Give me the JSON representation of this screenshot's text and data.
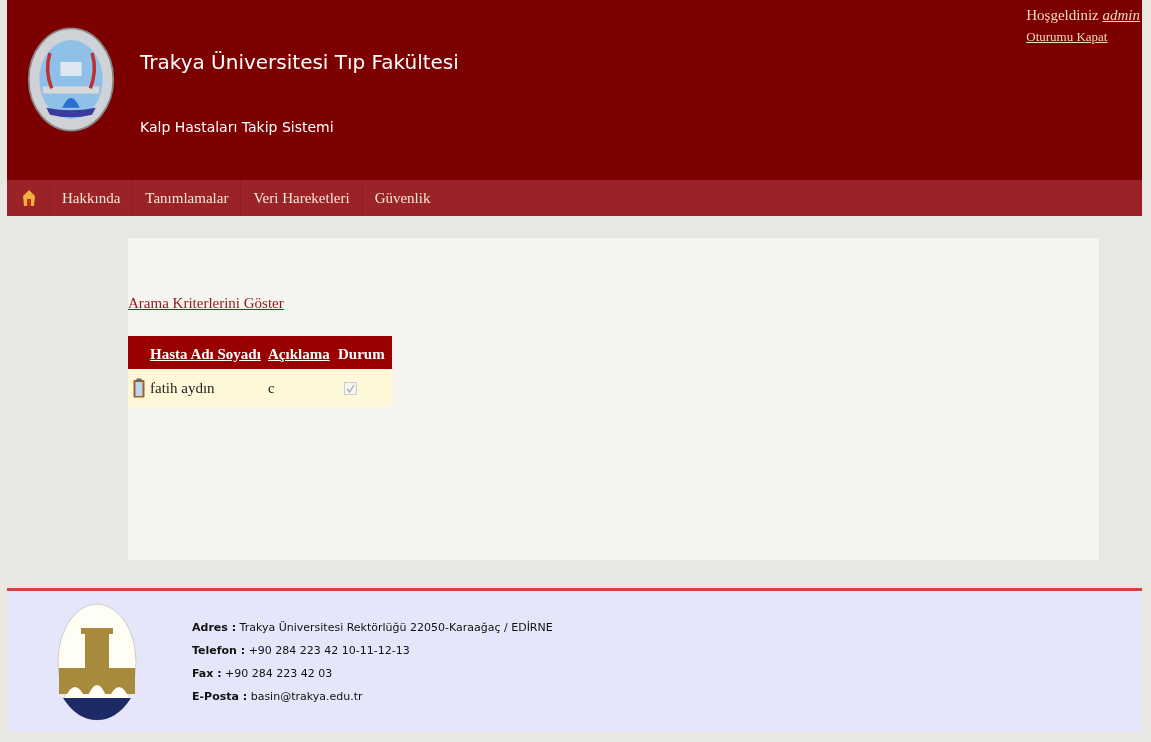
{
  "header": {
    "title": "Trakya Üniversitesi Tıp Fakültesi",
    "subtitle": "Kalp Hastaları Takip Sistemi",
    "welcome": "Hoşgeldiniz",
    "user": "admin",
    "logout": "Oturumu Kapat"
  },
  "nav": {
    "items": [
      {
        "label": "Hakkında"
      },
      {
        "label": "Tanımlamalar"
      },
      {
        "label": "Veri Hareketleri"
      },
      {
        "label": "Güvenlik"
      }
    ]
  },
  "search_link": "Arama Kriterlerini Göster",
  "table": {
    "columns": [
      "Hasta Adı Soyadı",
      "Açıklama",
      "Durum"
    ],
    "rows": [
      {
        "name": "fatih aydın",
        "description": "c",
        "status": {
          "checked": true,
          "disabled": true
        }
      }
    ]
  },
  "footer": {
    "lines": [
      {
        "label": "Adres :",
        "value": "Trakya Üniversitesi Rektörlüğü 22050-Karaağaç / EDİRNE"
      },
      {
        "label": "Telefon :",
        "value": "+90 284 223 42 10-11-12-13"
      },
      {
        "label": "Fax :",
        "value": "+90 284 223 42 03"
      },
      {
        "label": "E-Posta :",
        "value": "basin@trakya.edu.tr"
      }
    ]
  }
}
